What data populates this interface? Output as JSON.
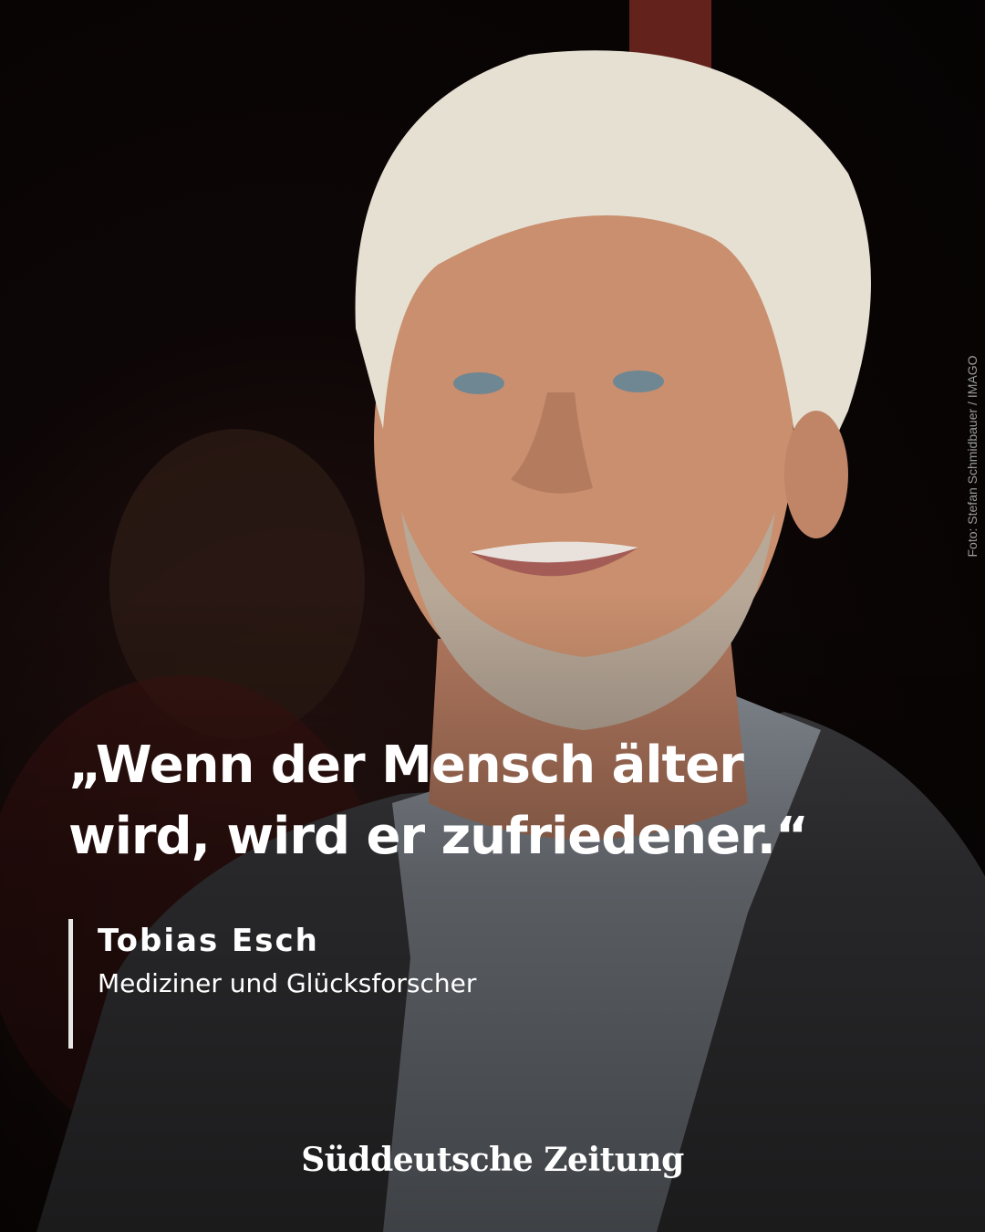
{
  "quote": {
    "line1": "„Wenn der Mensch älter",
    "line2": "wird, wird er zufriedener.“"
  },
  "attribution": {
    "name": "Tobias Esch",
    "role": "Mediziner und Glücksforscher"
  },
  "photo_credit": "Foto: Stefan Schmidbauer / IMAGO",
  "logo": "Süddeutsche Zeitung",
  "colors": {
    "text": "#ffffff",
    "accent_bar": "#e6e6e6",
    "background": "#050303"
  }
}
